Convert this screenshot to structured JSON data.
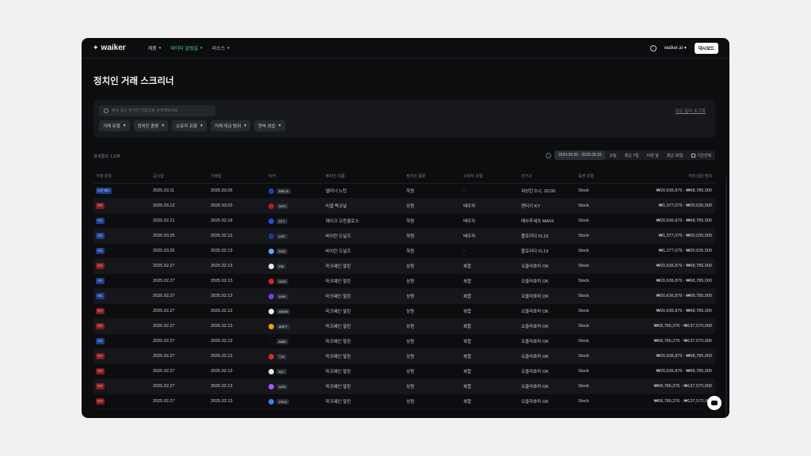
{
  "nav": {
    "logo": "waiker",
    "items": [
      {
        "label": "제품",
        "active": false
      },
      {
        "label": "데이터 알림실",
        "active": true
      },
      {
        "label": "리소스",
        "active": false
      }
    ],
    "site": "waiker.ai",
    "dashboard": "대시보드"
  },
  "page": {
    "title": "정치인 거래 스크리너"
  },
  "filters": {
    "search_placeholder": "종목 또는 정치인 이름으로 검색해보세요",
    "reset": "모든 필터 초기화",
    "chips": [
      "거래 유형",
      "정치인 종류",
      "소유자 유형",
      "거래 대금 범위",
      "연속 성습"
    ]
  },
  "results": {
    "label": "검색결과: 1,528"
  },
  "date": {
    "range": "2024.09.20 - 2025.09.20",
    "options": [
      "오늘",
      "최근 7일",
      "이번 달",
      "최근 30일"
    ],
    "custom": "기간선택"
  },
  "columns": [
    "거래 유형",
    "공시일",
    "거래일",
    "티커",
    "정치인 이름",
    "정치인 종류",
    "소유자 유형",
    "선거구",
    "증권 유형",
    "거래 대금 범위"
  ],
  "rows": [
    {
      "type": "부분 매도",
      "kind": "mixed",
      "filed": "2025.03.11",
      "traded": "2025.03.05",
      "ticker": "BRK.B",
      "logo": "#1e40af",
      "name": "엘리너 노턴",
      "chamber": "하원",
      "owner": "-",
      "district": "워싱턴 D.C. DC00",
      "asset": "Stock",
      "amount": "₩20,636,876 - ₩68,785,000"
    },
    {
      "type": "매수",
      "kind": "sell",
      "filed": "2025.03.12",
      "traded": "2025.03.03",
      "ticker": "WFC",
      "logo": "#b91c1c",
      "name": "미셸 맥코널",
      "chamber": "상원",
      "owner": "배우자",
      "district": "켄터키 KY",
      "asset": "Stock",
      "amount": "₩1,377,076 - ₩20,635,500"
    },
    {
      "type": "매도",
      "kind": "buy",
      "filed": "2025.02.21",
      "traded": "2025.02.18",
      "ticker": "STT",
      "logo": "#1d4ed8",
      "name": "제이크 오친클로스",
      "chamber": "하원",
      "owner": "배우자",
      "district": "매사추세츠 MA04",
      "asset": "Stock",
      "amount": "₩20,636,876 - ₩68,785,000"
    },
    {
      "type": "매도",
      "kind": "buy",
      "filed": "2025.03.25",
      "traded": "2025.02.13",
      "ticker": "LMT",
      "logo": "#1e3a8a",
      "name": "바이런 도널즈",
      "chamber": "하원",
      "owner": "배우자",
      "district": "플로리다 FL19",
      "asset": "Stock",
      "amount": "₩1,377,076 - ₩20,635,500"
    },
    {
      "type": "매도",
      "kind": "buy",
      "filed": "2025.03.25",
      "traded": "2025.02.13",
      "ticker": "FDS",
      "logo": "#60a5fa",
      "name": "바이런 도널즈",
      "chamber": "하원",
      "owner": "-",
      "district": "플로리다 FL19",
      "asset": "Stock",
      "amount": "₩1,377,076 - ₩20,635,500"
    },
    {
      "type": "매수",
      "kind": "sell",
      "filed": "2025.02.27",
      "traded": "2025.02.13",
      "ticker": "PM",
      "logo": "#e5e7eb",
      "name": "마크웨인 멀린",
      "chamber": "상원",
      "owner": "복합",
      "district": "오클라호마 OK",
      "asset": "Stock",
      "amount": "₩20,636,876 - ₩68,785,000"
    },
    {
      "type": "매도",
      "kind": "buy",
      "filed": "2025.02.27",
      "traded": "2025.02.13",
      "ticker": "HON",
      "logo": "#dc2626",
      "name": "마크웨인 멀린",
      "chamber": "상원",
      "owner": "복합",
      "district": "오클라호마 OK",
      "asset": "Stock",
      "amount": "₩20,636,876 - ₩68,785,000"
    },
    {
      "type": "매도",
      "kind": "buy",
      "filed": "2025.02.27",
      "traded": "2025.02.13",
      "ticker": "DHR",
      "logo": "#7c3aed",
      "name": "마크웨인 멀린",
      "chamber": "상원",
      "owner": "복합",
      "district": "오클라호마 OK",
      "asset": "Stock",
      "amount": "₩20,636,876 - ₩68,785,000"
    },
    {
      "type": "매수",
      "kind": "sell",
      "filed": "2025.02.27",
      "traded": "2025.02.13",
      "ticker": "AMZN",
      "logo": "#f5f5f5",
      "name": "마크웨인 멀린",
      "chamber": "상원",
      "owner": "복합",
      "district": "오클라호마 OK",
      "asset": "Stock",
      "amount": "₩20,636,876 - ₩68,785,000"
    },
    {
      "type": "매수",
      "kind": "sell",
      "filed": "2025.02.27",
      "traded": "2025.02.13",
      "ticker": "MSFT",
      "logo": "#f59e0b",
      "name": "마크웨인 멀린",
      "chamber": "상원",
      "owner": "복합",
      "district": "오클라호마 OK",
      "asset": "Stock",
      "amount": "₩68,786,376 - ₩137,570,000"
    },
    {
      "type": "매도",
      "kind": "buy",
      "filed": "2025.02.27",
      "traded": "2025.02.13",
      "ticker": "AMD",
      "logo": "#111111",
      "name": "마크웨인 멀린",
      "chamber": "상원",
      "owner": "복합",
      "district": "오클라호마 OK",
      "asset": "Stock",
      "amount": "₩68,786,376 - ₩137,570,000"
    },
    {
      "type": "매수",
      "kind": "sell",
      "filed": "2025.02.27",
      "traded": "2025.02.13",
      "ticker": "TJX",
      "logo": "#dc2626",
      "name": "마크웨인 멀린",
      "chamber": "상원",
      "owner": "복합",
      "district": "오클라호마 OK",
      "asset": "Stock",
      "amount": "₩20,636,876 - ₩68,785,000"
    },
    {
      "type": "매수",
      "kind": "sell",
      "filed": "2025.02.27",
      "traded": "2025.02.13",
      "ticker": "IQV",
      "logo": "#e5e7eb",
      "name": "마크웨인 멀린",
      "chamber": "상원",
      "owner": "복합",
      "district": "오클라호마 OK",
      "asset": "Stock",
      "amount": "₩20,636,876 - ₩68,785,000"
    },
    {
      "type": "매수",
      "kind": "sell",
      "filed": "2025.02.27",
      "traded": "2025.02.13",
      "ticker": "ACN",
      "logo": "#a855f7",
      "name": "마크웨인 멀린",
      "chamber": "상원",
      "owner": "복합",
      "district": "오클라호마 OK",
      "asset": "Stock",
      "amount": "₩68,786,376 - ₩137,570,000"
    },
    {
      "type": "매수",
      "kind": "sell",
      "filed": "2025.02.27",
      "traded": "2025.02.13",
      "ticker": "LRLA",
      "logo": "#3b82f6",
      "name": "마크웨인 멀린",
      "chamber": "상원",
      "owner": "복합",
      "district": "오클라호마 OK",
      "asset": "Stock",
      "amount": "₩68,786,376 - ₩137,570,000"
    }
  ]
}
